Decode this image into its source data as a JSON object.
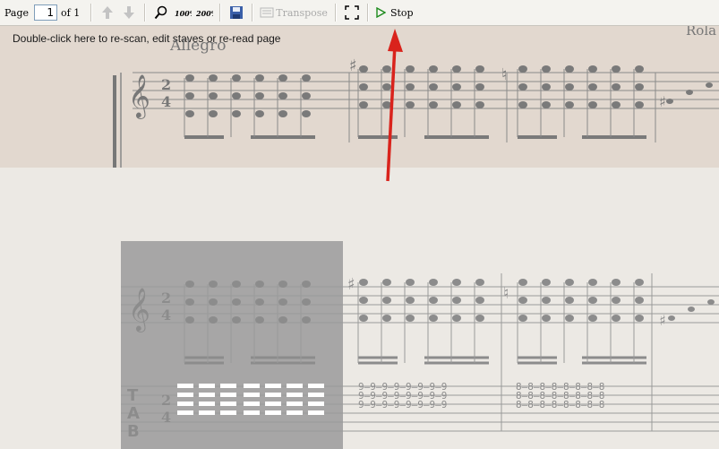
{
  "toolbar": {
    "page_label": "Page",
    "page_value": "1",
    "of_label": "of 1",
    "zoom_100": "100%",
    "zoom_200": "200%",
    "transpose_label": "Transpose",
    "stop_label": "Stop"
  },
  "score": {
    "hint": "Double-click here to re-scan, edit staves or re-read page",
    "tempo": "Allegro",
    "composer": "Rola",
    "time_sig_top": "2",
    "time_sig_bottom": "4",
    "tab_letters": [
      "T",
      "A",
      "B"
    ],
    "tab_numbers_row": "9—9—9—9—9—9—9—9",
    "tab_numbers_row2": "8—8—8—8—8—8—8—8"
  },
  "colors": {
    "accent_arrow": "#d9231c",
    "score_background": "#e2d8cf",
    "page_background": "#ece9e4"
  }
}
